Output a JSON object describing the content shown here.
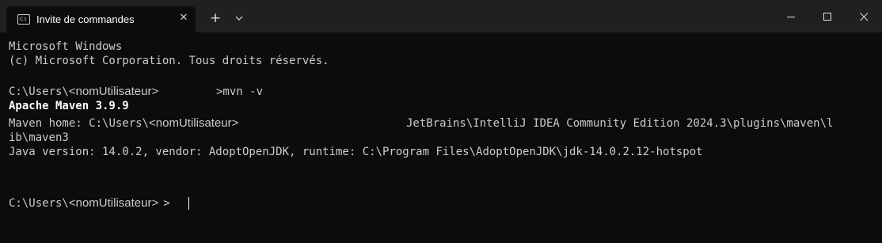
{
  "window": {
    "tab_title": "Invite de commandes",
    "tab_icon": "cmd-icon",
    "close_tab": "✕",
    "new_tab": "+"
  },
  "terminal": {
    "header_line1": "Microsoft Windows",
    "header_line2": "(c) Microsoft Corporation. Tous droits réservés.",
    "prompt_path": "C:\\Users\\",
    "prompt_user": "<nomUtilisateur>",
    "prompt_gt": ">",
    "command": ">mvn -v",
    "maven_version": "Apache Maven 3.9.9",
    "maven_home_label": "Maven home: ",
    "maven_home_path_part": "C:\\Users\\",
    "maven_home_path_rest": "JetBrains\\IntelliJ IDEA Community Edition 2024.3\\plugins\\maven\\l",
    "maven_home_line2": "ib\\maven3",
    "java_version": "Java version: 14.0.2, vendor: AdoptOpenJDK, runtime: C:\\Program Files\\AdoptOpenJDK\\jdk-14.0.2.12-hotspot"
  }
}
